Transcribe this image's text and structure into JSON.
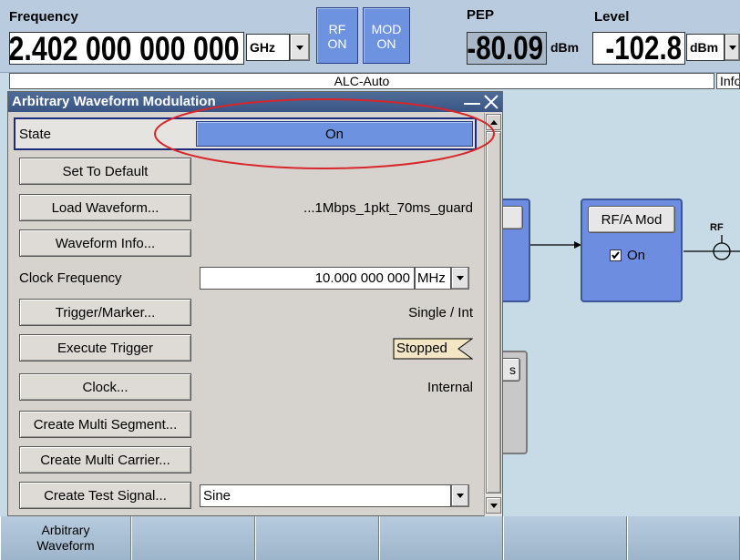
{
  "header": {
    "frequency_label": "Frequency",
    "frequency_value": "2.402 000 000 000",
    "frequency_unit": "GHz",
    "rf_label_1": "RF",
    "rf_label_2": "ON",
    "mod_label_1": "MOD",
    "mod_label_2": "ON",
    "pep_label": "PEP",
    "pep_value": "-80.09",
    "pep_unit": "dBm",
    "level_label": "Level",
    "level_value": "-102.8",
    "level_unit": "dBm",
    "alc_status": "ALC-Auto",
    "info_label": "Info"
  },
  "diagram": {
    "rfa_mod_label": "RF/A Mod",
    "rfa_on_label": "On",
    "rf_label": "RF",
    "partial_btn_label": "s"
  },
  "dialog": {
    "title": "Arbitrary Waveform Modulation",
    "state_label": "State",
    "state_value": "On",
    "set_default": "Set To Default",
    "load_waveform": "Load Waveform...",
    "loaded_file": "...1Mbps_1pkt_70ms_guard",
    "waveform_info": "Waveform Info...",
    "clock_freq_label": "Clock Frequency",
    "clock_freq_value": "10.000 000 000",
    "clock_freq_unit": "MHz",
    "trigger_marker": "Trigger/Marker...",
    "trigger_mode": "Single / Int",
    "execute_trigger": "Execute Trigger",
    "trigger_status": "Stopped",
    "clock_btn": "Clock...",
    "clock_source": "Internal",
    "create_multi_segment": "Create Multi Segment...",
    "create_multi_carrier": "Create Multi Carrier...",
    "create_test_signal": "Create Test Signal...",
    "test_signal_value": "Sine"
  },
  "softkeys": {
    "key1_line1": "Arbitrary",
    "key1_line2": "Waveform"
  },
  "colors": {
    "highlight_ellipse": "#d8262b",
    "state_on_bg": "#6d93e0"
  }
}
